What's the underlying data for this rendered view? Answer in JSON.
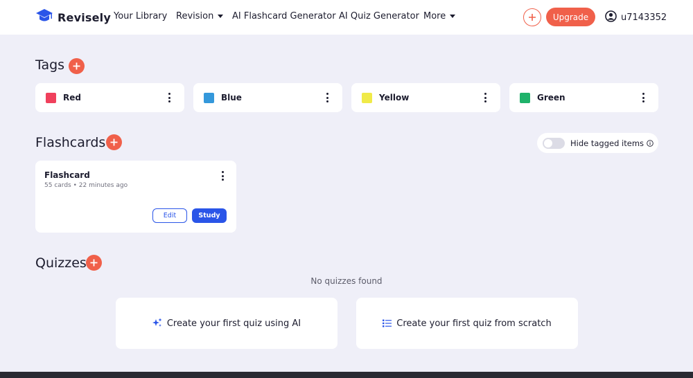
{
  "nav": {
    "brand": "Revisely",
    "links": [
      "Your Library",
      "Revision",
      "AI Flashcard Generator",
      "AI Quiz Generator",
      "More"
    ],
    "upgrade_label": "Upgrade",
    "username": "u7143352",
    "icons": [
      "graduation-cap-icon",
      "plus-icon",
      "user-circle-icon"
    ]
  },
  "tags": {
    "title": "Tags",
    "items": [
      {
        "label": "Red",
        "color": "#f0405c"
      },
      {
        "label": "Blue",
        "color": "#3498db"
      },
      {
        "label": "Yellow",
        "color": "#f0ea48"
      },
      {
        "label": "Green",
        "color": "#1fb26a"
      }
    ]
  },
  "flashcards": {
    "title": "Flashcards",
    "hide_tagged_label": "Hide tagged items",
    "cards": [
      {
        "title": "Flashcard",
        "meta": "55 cards • 22 minutes ago",
        "edit_label": "Edit",
        "study_label": "Study"
      }
    ]
  },
  "quizzes": {
    "title": "Quizzes",
    "empty_text": "No quizzes found",
    "create_ai_label": "Create your first quiz using AI",
    "create_scratch_label": "Create your first quiz from scratch"
  },
  "colors": {
    "accent": "#f0604a",
    "primary": "#2a55e8",
    "background": "#efeff8"
  }
}
